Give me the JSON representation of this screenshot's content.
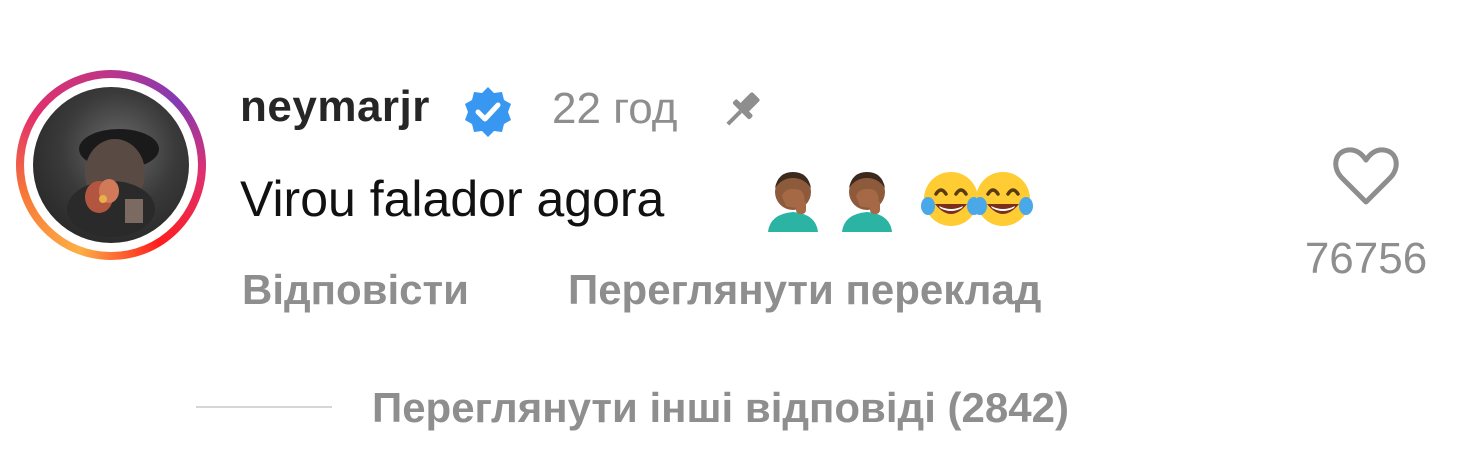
{
  "comment": {
    "username": "neymarjr",
    "time": "22 год",
    "text": "Virou falador agora",
    "emojis": [
      "facepalm-emoji",
      "facepalm-emoji",
      "tears-of-joy-emoji",
      "tears-of-joy-emoji"
    ],
    "reply_label": "Відповісти",
    "translate_label": "Переглянути переклад",
    "like_count": "76756",
    "more_replies_label": "Переглянути інші відповіді (2842)"
  },
  "icons": {
    "verified": "verified-badge-icon",
    "pin": "pin-icon",
    "like": "heart-icon"
  },
  "colors": {
    "verified_blue": "#3897f0",
    "muted_text": "#8e8e8e",
    "primary_text": "#262626"
  }
}
